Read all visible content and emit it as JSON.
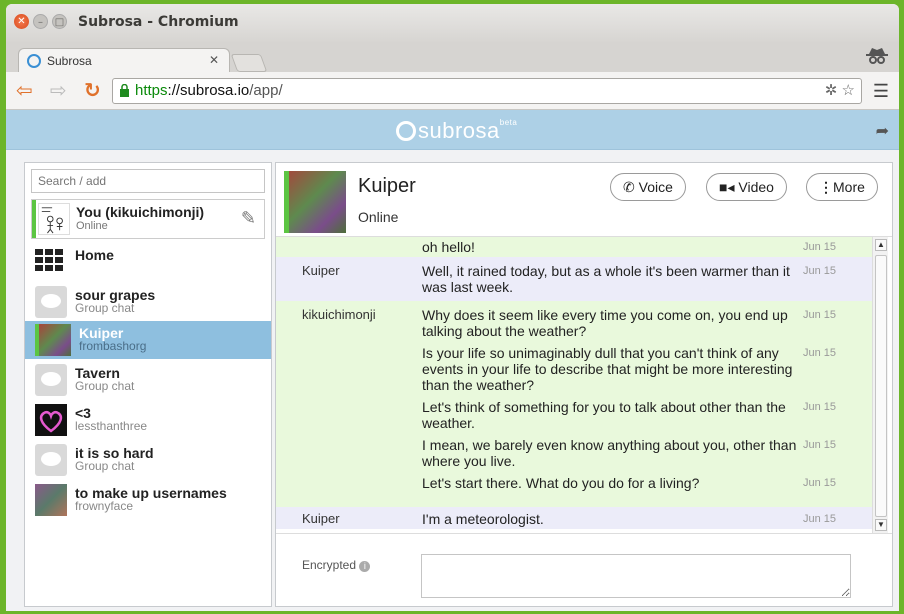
{
  "window": {
    "title": "Subrosa - Chromium"
  },
  "browser": {
    "tab_title": "Subrosa",
    "url_scheme": "https",
    "url_host": "://subrosa.io",
    "url_path": "/app/"
  },
  "app": {
    "logo_text": "subrosa",
    "logo_badge": "beta"
  },
  "sidebar": {
    "search_placeholder": "Search / add",
    "me": {
      "name": "You (kikuichimonji)",
      "status": "Online"
    },
    "items": [
      {
        "title": "Home",
        "subtitle": "",
        "icon": "grid-icon"
      },
      {
        "title": "sour grapes",
        "subtitle": "Group chat",
        "icon": "chat-bubble-icon"
      },
      {
        "title": "Kuiper",
        "subtitle": "frombashorg",
        "icon": "avatar",
        "selected": true
      },
      {
        "title": "Tavern",
        "subtitle": "Group chat",
        "icon": "chat-bubble-icon"
      },
      {
        "title": "<3",
        "subtitle": "lessthanthree",
        "icon": "avatar"
      },
      {
        "title": "it is so hard",
        "subtitle": "Group chat",
        "icon": "chat-bubble-icon"
      },
      {
        "title": "to make up usernames",
        "subtitle": "frownyface",
        "icon": "avatar"
      }
    ]
  },
  "chat": {
    "name": "Kuiper",
    "status": "Online",
    "buttons": {
      "voice": "Voice",
      "video": "Video",
      "more": "More"
    },
    "messages": [
      {
        "author": "",
        "text": "oh hello!",
        "date": "Jun 15"
      },
      {
        "author": "Kuiper",
        "text": "Well, it rained today, but as a whole it's been warmer than it was last week.",
        "date": "Jun 15"
      },
      {
        "author": "kikuichimonji",
        "text": "Why does it seem like every time you come on, you end up talking about the weather?",
        "date": "Jun 15"
      },
      {
        "author": "",
        "text": "Is your life so unimaginably dull that you can't think of any events in your life to describe that might be more interesting than the weather?",
        "date": "Jun 15"
      },
      {
        "author": "",
        "text": "Let's think of something for you to talk about other than the weather.",
        "date": "Jun 15"
      },
      {
        "author": "",
        "text": "I mean, we barely even know anything about you, other than where you live.",
        "date": "Jun 15"
      },
      {
        "author": "",
        "text": "Let's start there. What do you do for a living?",
        "date": "Jun 15"
      },
      {
        "author": "Kuiper",
        "text": "I'm a meteorologist.",
        "date": "Jun 15"
      }
    ],
    "composer_label": "Encrypted",
    "composer_value": ""
  },
  "colors": {
    "accent_green": "#5cc542",
    "header_blue": "#add0e6",
    "selected_blue": "#8ebfdf",
    "mine_bg": "#e9f9dc",
    "theirs_bg": "#ececf9"
  }
}
